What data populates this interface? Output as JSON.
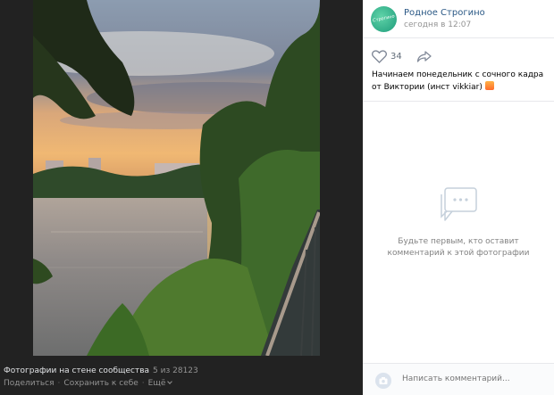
{
  "viewer": {
    "album_title": "Фотографии на стене сообщества",
    "position": "5 из 28123",
    "actions": {
      "share": "Поделиться",
      "save": "Сохранить к себе",
      "more": "Ещё"
    }
  },
  "post": {
    "author": "Родное Строгино",
    "date": "сегодня в 12:07",
    "avatar_text": "Строгино",
    "likes": "34",
    "caption": "Начинаем понедельник с сочного кадра от Виктории (инст vikkiar)"
  },
  "comments": {
    "empty_text": "Будьте первым, кто оставит комментарий к этой фотографии",
    "input_placeholder": "Написать комментарий..."
  },
  "icons": [
    "heart-icon",
    "share-icon",
    "comments-icon",
    "camera-icon",
    "chevron-down-icon",
    "sunset-emoji-icon"
  ],
  "colors": {
    "link": "#2a5885",
    "muted": "#939393",
    "viewer_bg": "#222222"
  }
}
